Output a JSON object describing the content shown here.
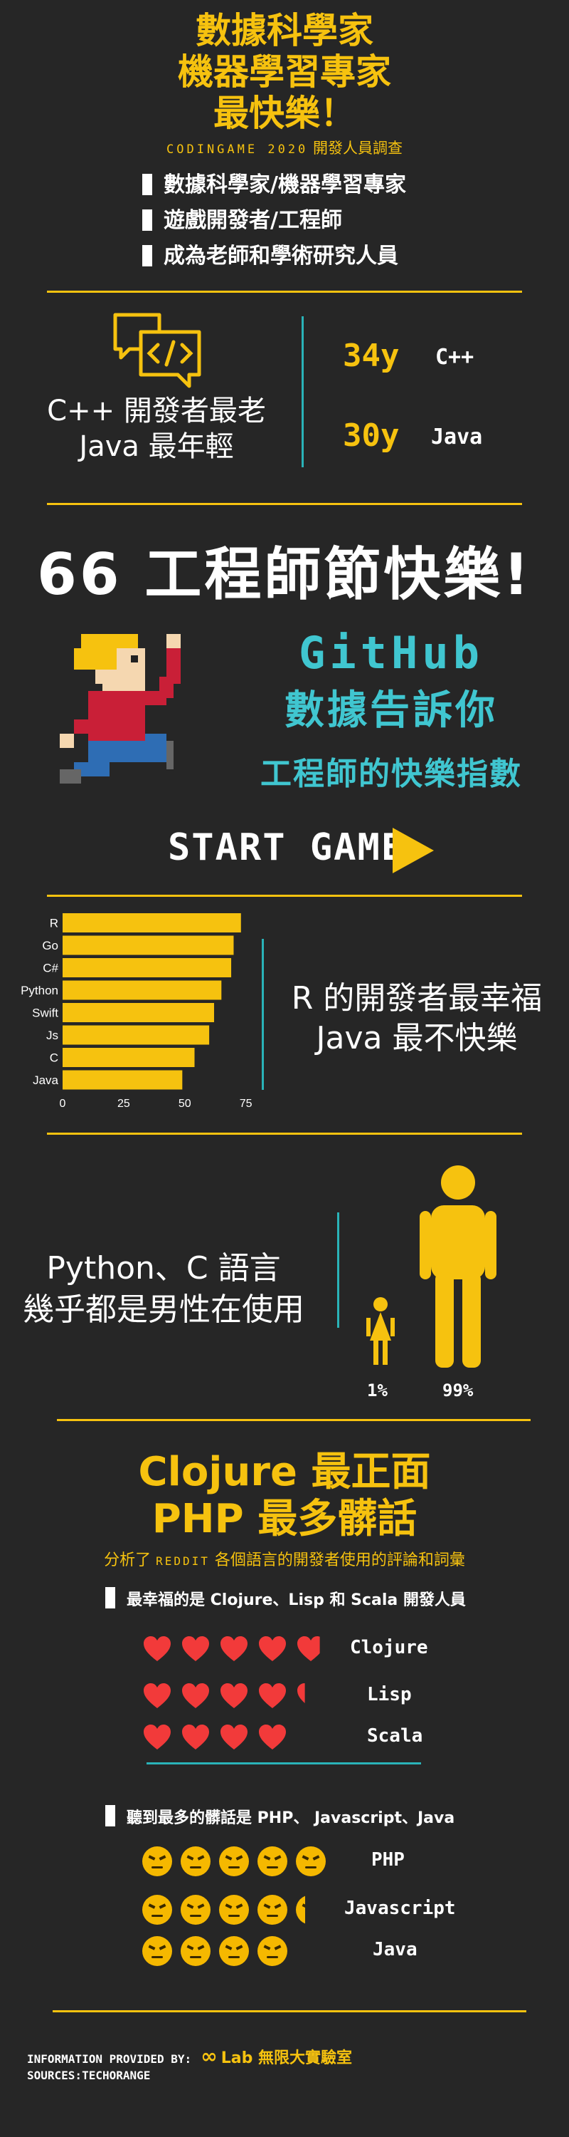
{
  "header": {
    "title_lines": [
      "數據科學家",
      "機器學習專家",
      "最快樂！"
    ],
    "subtitle_en": "CODINGAME 2020",
    "subtitle_zh": "開發人員調查",
    "bullets": [
      "數據科學家/機器學習專家",
      "遊戲開發者/工程師",
      "成為老師和學術研究人員"
    ]
  },
  "age": {
    "heading_lines": [
      "C++ 開發者最老",
      "Java 最年輕"
    ],
    "oldest": {
      "age": "34y",
      "lang": "C++"
    },
    "youngest": {
      "age": "30y",
      "lang": "Java"
    }
  },
  "banner": {
    "title": "66 工程師節快樂!",
    "github": "GitHub",
    "github_sub": "數據告訴你",
    "index_label": "工程師的快樂指數",
    "start": "START GAME"
  },
  "colors": {
    "accent": "#f6c20f",
    "teal": "#40c6d0",
    "background": "#262626"
  },
  "chart_data": {
    "type": "bar",
    "orientation": "horizontal",
    "categories": [
      "R",
      "Go",
      "C#",
      "Python",
      "Swift",
      "Js",
      "C",
      "Java"
    ],
    "values": [
      73,
      70,
      69,
      65,
      62,
      60,
      54,
      49
    ],
    "xticks": [
      "0",
      "25",
      "50",
      "75"
    ],
    "xlim": [
      0,
      85
    ],
    "title": "",
    "xlabel": "",
    "ylabel": ""
  },
  "happy": {
    "heading_lines": [
      "R 的開發者最幸福",
      "Java 最不快樂"
    ]
  },
  "gender": {
    "heading_lines": [
      "Python、C 語言",
      "幾乎都是男性在使用"
    ],
    "female_pct": "1%",
    "male_pct": "99%"
  },
  "sentiment": {
    "title_lines": [
      "Clojure 最正面",
      "PHP 最多髒話"
    ],
    "subtitle_pre": "分析了",
    "subtitle_reddit": "REDDIT",
    "subtitle_post": "各個語言的開發者使用的評論和詞彙",
    "happiest_label": "最幸福的是 Clojure、Lisp 和 Scala 開發人員",
    "happy_rows": [
      {
        "lang": "Clojure",
        "hearts": 4.8
      },
      {
        "lang": "Lisp",
        "hearts": 4.3
      },
      {
        "lang": "Scala",
        "hearts": 4
      }
    ],
    "swear_label": "聽到最多的髒話是 PHP、 Javascript、Java",
    "swear_rows": [
      {
        "lang": "PHP",
        "faces": 5
      },
      {
        "lang": "Javascript",
        "faces": 4.3
      },
      {
        "lang": "Java",
        "faces": 4
      }
    ]
  },
  "footer": {
    "provided_by": "INFORMATION PROVIDED BY:",
    "lab": "Lab 無限大實驗室",
    "sources": "SOURCES:TECHORANGE"
  }
}
